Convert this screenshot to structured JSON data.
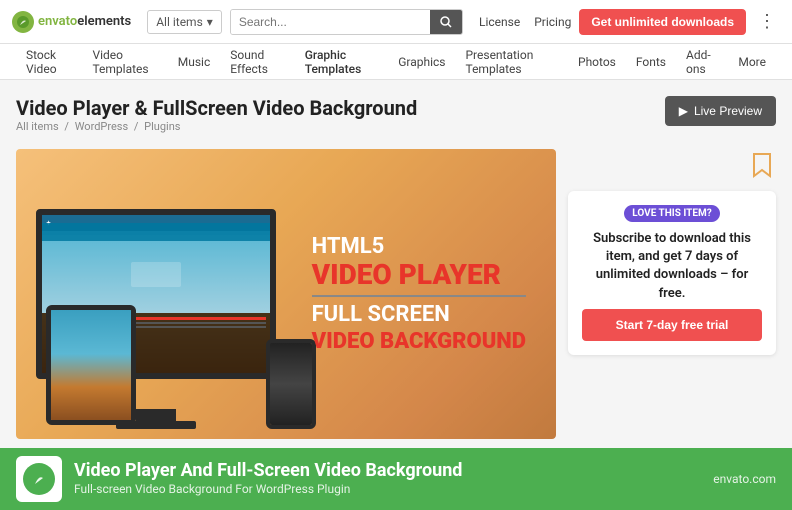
{
  "header": {
    "logo_text": "envato",
    "logo_suffix": "elements",
    "filter_label": "All items",
    "search_placeholder": "Search...",
    "nav_links": [
      {
        "label": "License",
        "href": "#"
      },
      {
        "label": "Pricing",
        "href": "#"
      }
    ],
    "cta_button": "Get unlimited downloads",
    "more_icon": "⋮"
  },
  "nav": {
    "items": [
      {
        "label": "Stock Video",
        "href": "#"
      },
      {
        "label": "Video Templates",
        "href": "#"
      },
      {
        "label": "Music",
        "href": "#"
      },
      {
        "label": "Sound Effects",
        "href": "#"
      },
      {
        "label": "Graphic Templates",
        "href": "#",
        "active": true
      },
      {
        "label": "Graphics",
        "href": "#"
      },
      {
        "label": "Presentation Templates",
        "href": "#"
      },
      {
        "label": "Photos",
        "href": "#"
      },
      {
        "label": "Fonts",
        "href": "#"
      },
      {
        "label": "Add-ons",
        "href": "#"
      },
      {
        "label": "More",
        "href": "#"
      }
    ]
  },
  "page": {
    "title": "Video Player & FullScreen Video Background",
    "breadcrumb": [
      "All items",
      "WordPress",
      "Plugins"
    ],
    "live_preview_label": "Live Preview",
    "preview_text": {
      "line1": "HTML5",
      "line2": "VIDEO PLAYER",
      "line3": "FULL SCREEN",
      "line4": "VIDEO BACKGROUND"
    }
  },
  "sidebar": {
    "love_badge": "LOVE THIS ITEM?",
    "cta_title": "Subscribe to download this item, and get 7 days of unlimited downloads – for free.",
    "cta_button": "Start 7-day free trial"
  },
  "bottom_bar": {
    "title": "Video Player And Full-Screen Video Background",
    "subtitle": "Full-screen Video Background For WordPress Plugin",
    "domain": "envato.com"
  },
  "icons": {
    "search": "🔍",
    "live_preview": "▶",
    "bookmark": "🔖",
    "leaf": "🍃"
  }
}
